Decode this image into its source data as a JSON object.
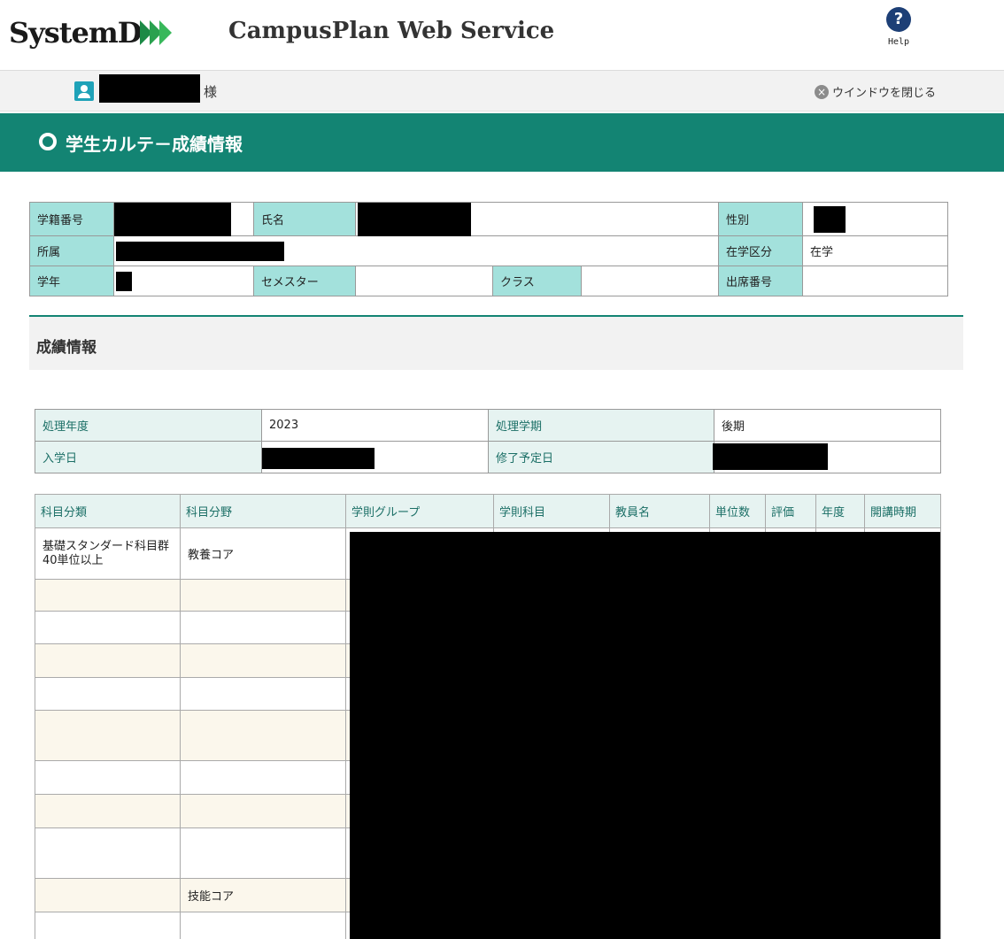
{
  "header": {
    "logo_text": "SystemD",
    "service_title": "CampusPlan Web Service",
    "help_label": "Help"
  },
  "userbar": {
    "user_suffix": "様",
    "close_window_label": "ウインドウを閉じる"
  },
  "page": {
    "title": "学生カルテ－成績情報"
  },
  "student_info": {
    "student_id_label": "学籍番号",
    "name_label": "氏名",
    "gender_label": "性別",
    "affiliation_label": "所属",
    "enrollment_status_label": "在学区分",
    "enrollment_status_value": "在学",
    "year_label": "学年",
    "semester_label": "セメスター",
    "class_label": "クラス",
    "attendance_no_label": "出席番号"
  },
  "grades_section": {
    "title": "成績情報",
    "process_year_label": "処理年度",
    "process_year_value": "2023",
    "process_term_label": "処理学期",
    "process_term_value": "後期",
    "admission_date_label": "入学日",
    "expected_completion_label": "修了予定日"
  },
  "grades_table": {
    "columns": [
      "科目分類",
      "科目分野",
      "学則グループ",
      "学則科目",
      "教員名",
      "単位数",
      "評価",
      "年度",
      "開講時期"
    ],
    "rows": [
      {
        "category": "基礎スタンダード科目群40単位以上",
        "field": "教養コア"
      },
      {
        "category": "",
        "field": ""
      },
      {
        "category": "",
        "field": ""
      },
      {
        "category": "",
        "field": ""
      },
      {
        "category": "",
        "field": ""
      },
      {
        "category": "",
        "field": ""
      },
      {
        "category": "",
        "field": ""
      },
      {
        "category": "",
        "field": ""
      },
      {
        "category": "",
        "field": ""
      },
      {
        "category": "",
        "field": "技能コア"
      },
      {
        "category": "",
        "field": ""
      }
    ]
  }
}
